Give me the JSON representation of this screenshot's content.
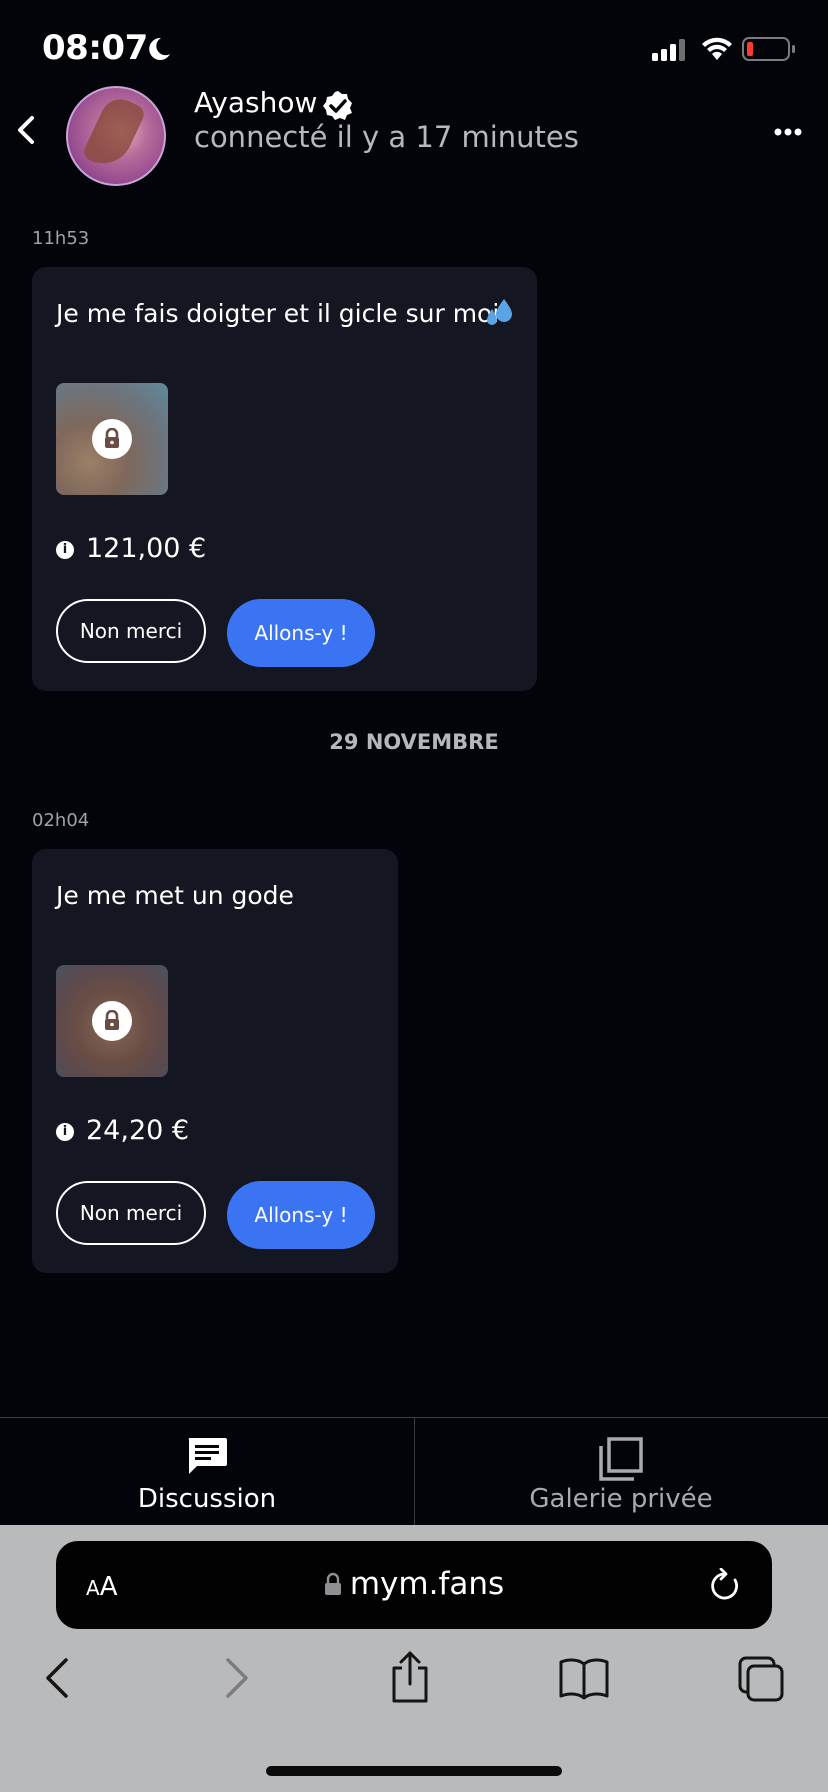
{
  "status_bar": {
    "time": "08:07"
  },
  "header": {
    "name": "Ayashow",
    "status": "connecté il y a 17 minutes"
  },
  "messages": [
    {
      "timestamp": "11h53",
      "text": "Je me fais doigter et il gicle sur moi",
      "price": "121,00 €",
      "decline_label": "Non merci",
      "accept_label": "Allons-y !"
    },
    {
      "timestamp": "02h04",
      "text": "Je me met un gode",
      "price": "24,20 €",
      "decline_label": "Non merci",
      "accept_label": "Allons-y !"
    }
  ],
  "date_separator": "29 NOVEMBRE",
  "tabs": [
    {
      "label": "Discussion",
      "icon": "chat-icon",
      "active": true
    },
    {
      "label": "Galerie privée",
      "icon": "gallery-icon",
      "active": false
    }
  ],
  "browser": {
    "text_size_small": "A",
    "text_size_large": "A",
    "url": "mym.fans"
  },
  "colors": {
    "accent": "#3a74f2",
    "background": "#03040a",
    "bubble": "#141722",
    "inactive_tab": "#a9aab0"
  }
}
